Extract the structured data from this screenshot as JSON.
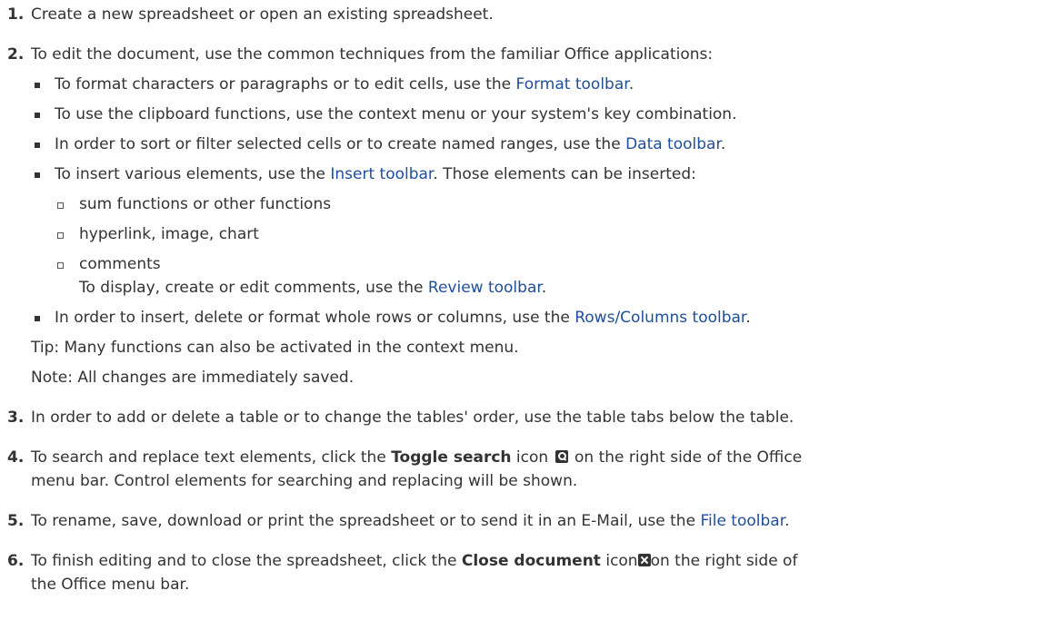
{
  "steps": {
    "s1": {
      "num": "1.",
      "text": "Create a new spreadsheet or open an existing spreadsheet."
    },
    "s2": {
      "num": "2.",
      "text": "To edit the document, use the common techniques from the familiar Office applications:",
      "b1": {
        "pre": "To format characters or paragraphs or to edit cells, use the ",
        "link": "Format toolbar",
        "post": "."
      },
      "b2": {
        "text": "To use the clipboard functions, use the context menu or your system's key combination."
      },
      "b3": {
        "pre": "In order to sort or filter selected cells or to create named ranges, use the ",
        "link": "Data toolbar",
        "post": "."
      },
      "b4": {
        "pre": "To insert various elements, use the ",
        "link": "Insert toolbar",
        "post": ". Those elements can be inserted:",
        "sub1": "sum functions or other functions",
        "sub2": "hyperlink, image, chart",
        "sub3": "comments",
        "sub3_pre": "To display, create or edit comments, use the ",
        "sub3_link": "Review toolbar",
        "sub3_post": "."
      },
      "b5": {
        "pre": "In order to insert, delete or format whole rows or columns, use the ",
        "link": "Rows/Columns toolbar",
        "post": "."
      },
      "tip": "Tip: Many functions can also be activated in the context menu.",
      "note": "Note: All changes are immediately saved."
    },
    "s3": {
      "num": "3.",
      "text": "In order to add or delete a table or to change the tables' order, use the table tabs below the table."
    },
    "s4": {
      "num": "4.",
      "pre": "To search and replace text elements, click the ",
      "bold": "Toggle search",
      "mid": " icon ",
      "icon": "search-icon",
      "post": " on the right side of the Office",
      "line2": "menu bar. Control elements for searching and replacing will be shown."
    },
    "s5": {
      "num": "5.",
      "pre": "To rename, save, download or print the spreadsheet or to send it in an E-Mail, use the ",
      "link": "File toolbar",
      "post": "."
    },
    "s6": {
      "num": "6.",
      "pre": "To finish editing and to close the spreadsheet, click the ",
      "bold": "Close document",
      "mid": " icon",
      "icon": "close-icon",
      "post": "on the right side of",
      "line2": "the Office menu bar."
    }
  },
  "colors": {
    "text": "#333333",
    "link": "#1f4e9c",
    "background": "#ffffff"
  }
}
